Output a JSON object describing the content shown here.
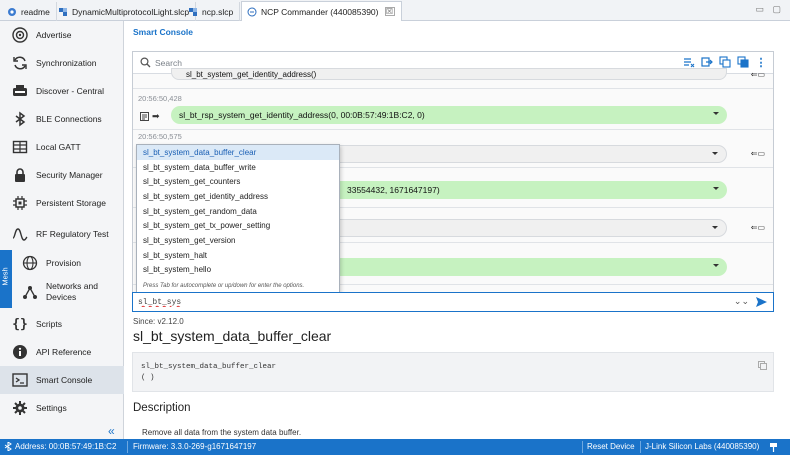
{
  "tabs": [
    {
      "label": "readme",
      "icon": "gear-icon"
    },
    {
      "label": "DynamicMultiprotocolLight.slcp",
      "icon": "project-icon"
    },
    {
      "label": "ncp.slcp",
      "icon": "project-icon"
    },
    {
      "label": "NCP Commander (440085390)",
      "icon": "console-icon",
      "close": "☒"
    }
  ],
  "sidebar": {
    "items": [
      {
        "label": "Advertise",
        "icon": "broadcast-icon"
      },
      {
        "label": "Synchronization",
        "icon": "sync-icon"
      },
      {
        "label": "Discover - Central",
        "icon": "printer-icon"
      },
      {
        "label": "BLE Connections",
        "icon": "bluetooth-icon"
      },
      {
        "label": "Local GATT",
        "icon": "table-icon"
      },
      {
        "label": "Security Manager",
        "icon": "lock-icon"
      },
      {
        "label": "Persistent Storage",
        "icon": "chip-icon"
      },
      {
        "label": "RF Regulatory Test",
        "icon": "wave-icon"
      },
      {
        "label": "Provision",
        "icon": "globe-icon"
      },
      {
        "label": "Networks and Devices",
        "label2": "Devices",
        "label1": "Networks and",
        "icon": "network-icon"
      },
      {
        "label": "Scripts",
        "icon": "braces-icon"
      },
      {
        "label": "API Reference",
        "icon": "info-icon"
      },
      {
        "label": "Smart Console",
        "icon": "terminal-icon"
      },
      {
        "label": "Settings",
        "icon": "gear-icon"
      }
    ],
    "mesh_label": "Mesh",
    "collapse_glyph": "«"
  },
  "main": {
    "title": "Smart Console",
    "search_placeholder": "Search",
    "console": {
      "partial_cmd": "sl_bt_system_get_identity_address()",
      "entries": [
        {
          "time": "20:56:50,428",
          "text": "sl_bt_rsp_system_get_identity_address(0, 00:0B:57:49:1B:C2, 0)"
        },
        {
          "time": "20:56:50,575",
          "text": ""
        },
        {
          "time": "",
          "text": "33554432, 1671647197)"
        }
      ]
    },
    "autocomplete": {
      "options": [
        "sl_bt_system_data_buffer_clear",
        "sl_bt_system_data_buffer_write",
        "sl_bt_system_get_counters",
        "sl_bt_system_get_identity_address",
        "sl_bt_system_get_random_data",
        "sl_bt_system_get_tx_power_setting",
        "sl_bt_system_get_version",
        "sl_bt_system_halt",
        "sl_bt_system_hello"
      ],
      "hint": "Press Tab for autocomplete or up/down for enter the options."
    },
    "input_value": "sl_bt_sys",
    "since": "Since: v2.12.0",
    "function_title": "sl_bt_system_data_buffer_clear",
    "code_line1": "sl_bt_system_data_buffer_clear",
    "code_line2": "( )",
    "description_heading": "Description",
    "description_text": "Remove all data from the system data buffer."
  },
  "statusbar": {
    "address": "Address: 00:0B:57:49:1B:C2",
    "firmware": "Firmware: 3.3.0-269-g1671647197",
    "reset": "Reset Device",
    "jlink": "J-Link Silicon Labs (440085390)"
  },
  "colors": {
    "accent": "#1a73c9",
    "event_green": "#c6f2c0",
    "selected_bg": "#dbe9f7"
  }
}
